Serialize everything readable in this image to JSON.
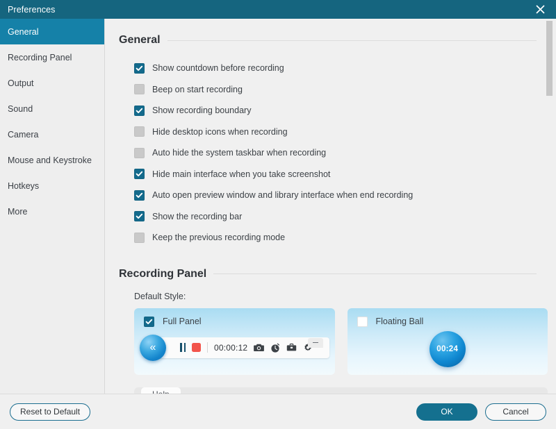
{
  "window": {
    "title": "Preferences",
    "close_icon": "close-icon"
  },
  "sidebar": {
    "items": [
      {
        "label": "General",
        "active": true
      },
      {
        "label": "Recording Panel",
        "active": false
      },
      {
        "label": "Output",
        "active": false
      },
      {
        "label": "Sound",
        "active": false
      },
      {
        "label": "Camera",
        "active": false
      },
      {
        "label": "Mouse and Keystroke",
        "active": false
      },
      {
        "label": "Hotkeys",
        "active": false
      },
      {
        "label": "More",
        "active": false
      }
    ]
  },
  "general": {
    "heading": "General",
    "options": [
      {
        "label": "Show countdown before recording",
        "checked": true
      },
      {
        "label": "Beep on start recording",
        "checked": false
      },
      {
        "label": "Show recording boundary",
        "checked": true
      },
      {
        "label": "Hide desktop icons when recording",
        "checked": false
      },
      {
        "label": "Auto hide the system taskbar when recording",
        "checked": false
      },
      {
        "label": "Hide main interface when you take screenshot",
        "checked": true
      },
      {
        "label": "Auto open preview window and library interface when end recording",
        "checked": true
      },
      {
        "label": "Show the recording bar",
        "checked": true
      },
      {
        "label": "Keep the previous recording mode",
        "checked": false
      }
    ]
  },
  "recording_panel": {
    "heading": "Recording Panel",
    "default_style_label": "Default Style:",
    "full_panel": {
      "label": "Full Panel",
      "checked": true,
      "timer": "00:00:12",
      "icons": [
        "collapse-left-icon",
        "pause-icon",
        "stop-icon",
        "camera-icon",
        "timer-icon",
        "toolbox-icon",
        "gear-icon",
        "minimize-icon"
      ]
    },
    "floating_ball": {
      "label": "Floating Ball",
      "checked": false,
      "timer": "00:24"
    }
  },
  "help_panel": {
    "tab_label": "Help"
  },
  "footer": {
    "reset_label": "Reset to Default",
    "ok_label": "OK",
    "cancel_label": "Cancel"
  },
  "colors": {
    "titlebar": "#15657F",
    "sidebar_active": "#1581A8",
    "checkbox_checked": "#136A8C",
    "primary_button": "#14708F",
    "stop_red": "#F2544B",
    "ball_blue": "#0E86CF"
  }
}
